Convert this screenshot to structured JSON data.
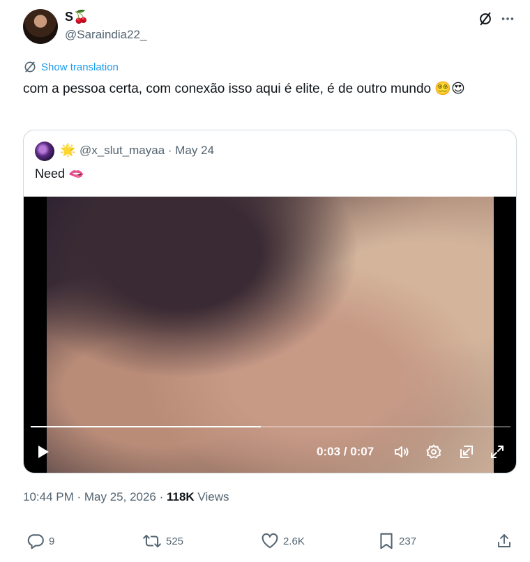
{
  "author": {
    "display_name": "S🍒",
    "handle": "@Saraindia22_"
  },
  "translate_label": "Show translation",
  "tweet_text": "com a pessoa certa, com conexão isso aqui é elite, é de outro mundo 😵‍💫😍",
  "quote": {
    "badge": "🌟",
    "handle_date": "@x_slut_mayaa · May 24",
    "text": "Need 🫦",
    "video": {
      "time": "0:03 / 0:07",
      "progress": 0.48
    }
  },
  "meta": {
    "time_date": "10:44 PM · May 25, 2026 · ",
    "views_count": "118K",
    "views_label": " Views"
  },
  "actions": {
    "replies": "9",
    "reposts": "525",
    "likes": "2.6K",
    "bookmarks": "237"
  },
  "colors": {
    "accent": "#1d9bf0",
    "text": "#0f1419",
    "secondary": "#536471",
    "border": "#cfd9de"
  }
}
